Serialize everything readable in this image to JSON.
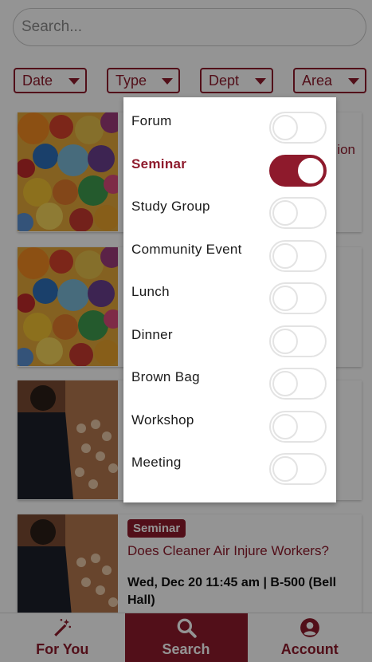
{
  "search": {
    "placeholder": "Search..."
  },
  "filters": [
    {
      "label": "Date"
    },
    {
      "label": "Type"
    },
    {
      "label": "Dept"
    },
    {
      "label": "Area"
    }
  ],
  "cards": [
    {
      "badge": "",
      "title": "ion",
      "meta": ""
    },
    {
      "badge": "",
      "title": "",
      "meta": ""
    },
    {
      "badge": "",
      "title": "",
      "meta": ""
    },
    {
      "badge": "Seminar",
      "title": "Does Cleaner Air Injure Workers?",
      "meta": "Wed, Dec 20 11:45 am | B-500 (Bell Hall)"
    }
  ],
  "type_panel": {
    "options": [
      {
        "label": "Forum",
        "on": false
      },
      {
        "label": "Seminar",
        "on": true
      },
      {
        "label": "Study Group",
        "on": false
      },
      {
        "label": "Community Event",
        "on": false
      },
      {
        "label": "Lunch",
        "on": false
      },
      {
        "label": "Dinner",
        "on": false
      },
      {
        "label": "Brown Bag",
        "on": false
      },
      {
        "label": "Workshop",
        "on": false
      },
      {
        "label": "Meeting",
        "on": false
      }
    ]
  },
  "bottom_nav": {
    "for_you": "For You",
    "search": "Search",
    "account": "Account"
  },
  "colors": {
    "brand": "#8e1a2c",
    "scrim": "rgba(0,0,0,0.42)"
  }
}
